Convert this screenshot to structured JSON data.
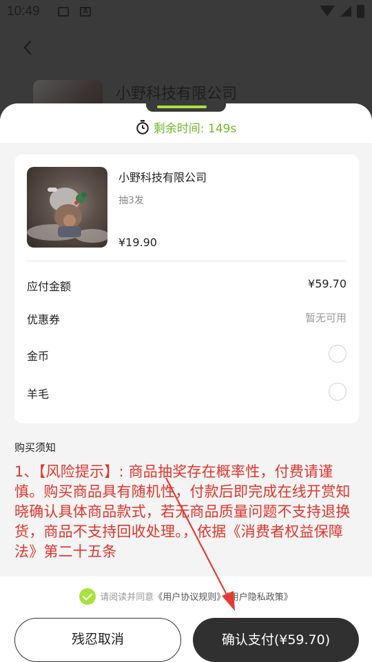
{
  "status_bar": {
    "time": "10:49",
    "icons": [
      "image-icon",
      "a-icon",
      "wifi-icon",
      "cell-signal-icon",
      "battery-icon"
    ]
  },
  "background_page": {
    "title": "小野科技有限公司"
  },
  "timer": {
    "text": "剩余时间: 149s",
    "color": "#6fba2c"
  },
  "order": {
    "product_name": "小野科技有限公司",
    "product_spec": "抽3发",
    "product_price": "¥19.90",
    "rows": [
      {
        "label": "应付金额",
        "value": "¥59.70"
      },
      {
        "label": "优惠券",
        "value": "暂无可用"
      },
      {
        "label": "金币"
      },
      {
        "label": "羊毛"
      }
    ]
  },
  "notice": {
    "title": "购买须知",
    "text": "1、【风险提示】: 商品抽奖存在概率性，付费请谨慎。购买商品具有随机性，付款后即完成在线开赏知晓确认具体商品款式，若无商品质量问题不支持退换货，商品不支持回收处理。，依据《消费者权益保障法》第二十五条",
    "color": "#e0352b"
  },
  "agreement": {
    "prefix": "请阅读并同意",
    "link1": "《用户协议规则》",
    "link2": "《用户隐私政策》",
    "checked": true
  },
  "buttons": {
    "cancel": "残忍取消",
    "pay": "确认支付(¥59.70)"
  },
  "colors": {
    "accent": "#a7e23a",
    "primary_button": "#303030",
    "annotation_arrow": "#e53935"
  }
}
